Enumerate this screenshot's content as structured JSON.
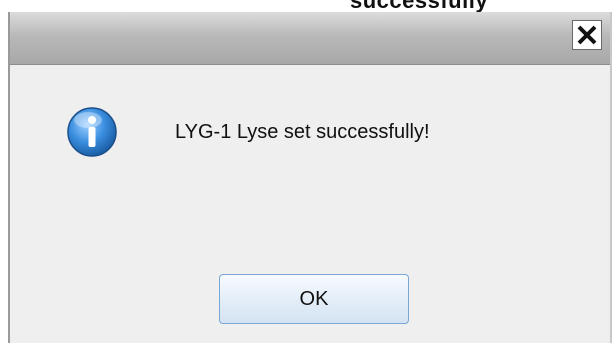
{
  "background_caption": "successfully",
  "dialog": {
    "close_glyph": "X",
    "message": "LYG-1 Lyse set successfully!",
    "icon": "info-icon",
    "ok_label": "OK"
  },
  "colors": {
    "title_bar": "#b9b9b9",
    "dialog_body": "#efefef",
    "icon_blue": "#2f7fd0",
    "button_border": "#7aa7d4"
  }
}
